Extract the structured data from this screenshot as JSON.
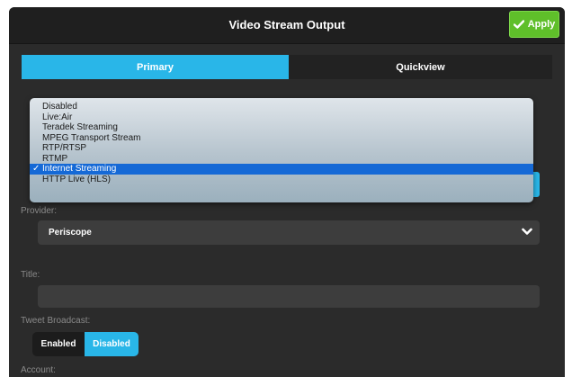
{
  "header": {
    "title": "Video Stream Output",
    "apply_label": "Apply"
  },
  "tabs": [
    {
      "label": "Primary",
      "active": true
    },
    {
      "label": "Quickview",
      "active": false
    }
  ],
  "mode_dropdown": {
    "options": [
      "Disabled",
      "Live:Air",
      "Teradek Streaming",
      "MPEG Transport Stream",
      "RTP/RTSP",
      "RTMP",
      "Internet Streaming",
      "HTTP Live (HLS)"
    ],
    "selected": "Internet Streaming",
    "check_glyph": "✓"
  },
  "provider": {
    "label": "Provider:",
    "value": "Periscope"
  },
  "title_field": {
    "label": "Title:",
    "value": ""
  },
  "tweet_broadcast": {
    "label": "Tweet Broadcast:",
    "options": [
      "Enabled",
      "Disabled"
    ],
    "selected": "Disabled"
  },
  "account": {
    "label": "Account:"
  },
  "colors": {
    "accent": "#29b6e8",
    "apply_green": "#5fbf2a",
    "panel_bg": "#2b2b2b",
    "selection_blue": "#1569d6"
  },
  "icons": {
    "apply": "checkmark-icon",
    "provider_select": "chevron-down-icon"
  }
}
